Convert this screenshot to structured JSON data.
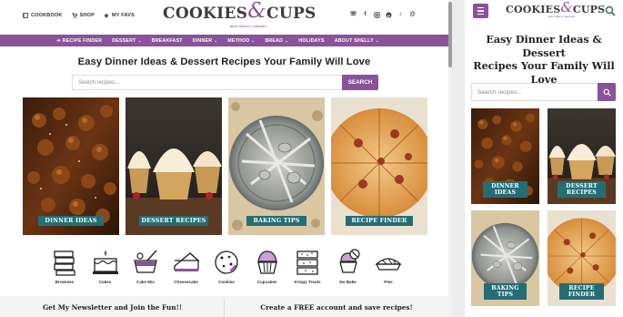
{
  "colors": {
    "brand_purple": "#8a5298",
    "teal_label": "#256d75",
    "text_dark": "#222222"
  },
  "header": {
    "links": [
      {
        "label": "COOKBOOK",
        "icon": "book-icon"
      },
      {
        "label": "SHOP",
        "icon": "cart-icon"
      },
      {
        "label": "MY FAVS",
        "icon": "star-icon"
      }
    ],
    "logo": {
      "word1": "COOKIES",
      "amp": "&",
      "word2": "CUPS",
      "tagline": "WITH SHELLY JAROSKY"
    },
    "social": [
      "phone-icon",
      "facebook-icon",
      "instagram-icon",
      "pinterest-icon",
      "tiktok-icon",
      "threads-icon"
    ]
  },
  "nav": {
    "items": [
      {
        "label": "RECIPE FINDER",
        "prefix": "➜",
        "caret": false
      },
      {
        "label": "DESSERT",
        "caret": true
      },
      {
        "label": "BREAKFAST",
        "caret": false
      },
      {
        "label": "DINNER",
        "caret": true
      },
      {
        "label": "METHOD",
        "caret": true
      },
      {
        "label": "BREAD",
        "caret": true
      },
      {
        "label": "HOLIDAYS",
        "caret": false
      },
      {
        "label": "ABOUT SHELLY",
        "caret": true
      }
    ]
  },
  "main": {
    "headline": "Easy Dinner Ideas & Dessert Recipes Your Family Will Love",
    "search": {
      "placeholder": "Search recipes...",
      "button": "SEARCH"
    },
    "cards": [
      {
        "label": "DINNER IDEAS",
        "image": "chicken-dish"
      },
      {
        "label": "DESSERT RECIPES",
        "image": "cupcakes"
      },
      {
        "label": "BAKING TIPS",
        "image": "bowl-of-spoons"
      },
      {
        "label": "RECIPE FINDER",
        "image": "pizza"
      }
    ],
    "categories": [
      {
        "label": "Brownies",
        "icon": "brownies-icon"
      },
      {
        "label": "Cakes",
        "icon": "cake-icon"
      },
      {
        "label": "Cake Mix",
        "icon": "cake-mix-icon"
      },
      {
        "label": "Cheesecake",
        "icon": "cheesecake-icon"
      },
      {
        "label": "Cookies",
        "icon": "cookie-icon"
      },
      {
        "label": "Cupcakes",
        "icon": "cupcake-icon"
      },
      {
        "label": "Krispy Treats",
        "icon": "krispy-treats-icon"
      },
      {
        "label": "No Bake",
        "icon": "no-bake-icon"
      },
      {
        "label": "Pies",
        "icon": "pie-icon"
      }
    ],
    "newsletter": "Get My Newsletter and Join the Fun!!",
    "account": "Create a FREE account and save recipes!"
  },
  "mobile": {
    "headline_lines": [
      "Easy Dinner Ideas & Dessert",
      "Recipes Your Family Will",
      "Love"
    ],
    "search_placeholder": "Search recipes...",
    "cards": [
      {
        "line1": "DINNER",
        "line2": "IDEAS"
      },
      {
        "line1": "DESSERT",
        "line2": "RECIPES"
      },
      {
        "line1": "BAKING",
        "line2": "TIPS"
      },
      {
        "line1": "RECIPE",
        "line2": "FINDER"
      }
    ]
  }
}
